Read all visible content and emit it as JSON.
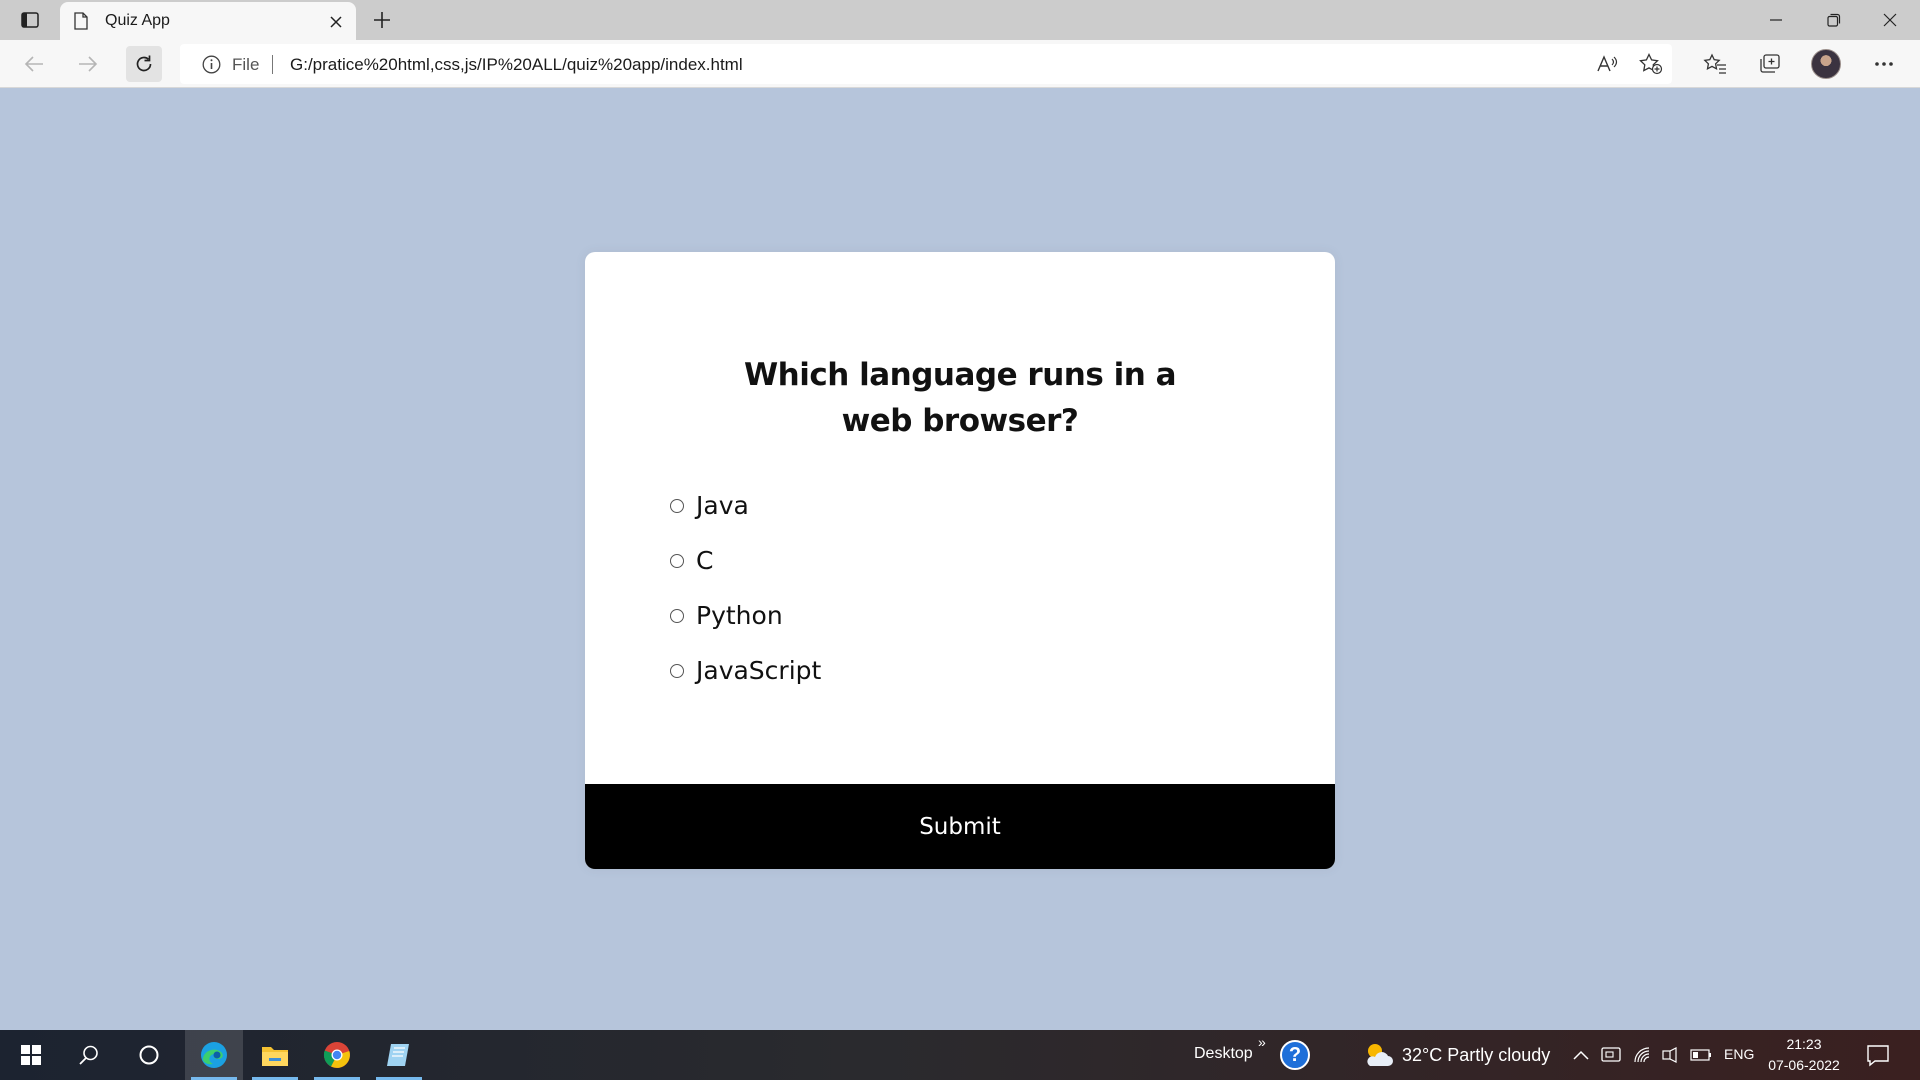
{
  "browser": {
    "tab_title": "Quiz App",
    "address": {
      "scheme_label": "File",
      "url": "G:/pratice%20html,css,js/IP%20ALL/quiz%20app/index.html"
    }
  },
  "quiz": {
    "question": "Which language runs in a web browser?",
    "answers": [
      {
        "id": "a",
        "label": "Java",
        "checked": false
      },
      {
        "id": "b",
        "label": "C",
        "checked": false
      },
      {
        "id": "c",
        "label": "Python",
        "checked": false
      },
      {
        "id": "d",
        "label": "JavaScript",
        "checked": false
      }
    ],
    "submit_label": "Submit"
  },
  "taskbar": {
    "desktop_label": "Desktop",
    "weather": "32°C  Partly cloudy",
    "language": "ENG",
    "time": "21:23",
    "date": "07-06-2022"
  },
  "colors": {
    "page_background": "#b6c5db",
    "card_background": "#ffffff",
    "submit_background": "#000000"
  }
}
